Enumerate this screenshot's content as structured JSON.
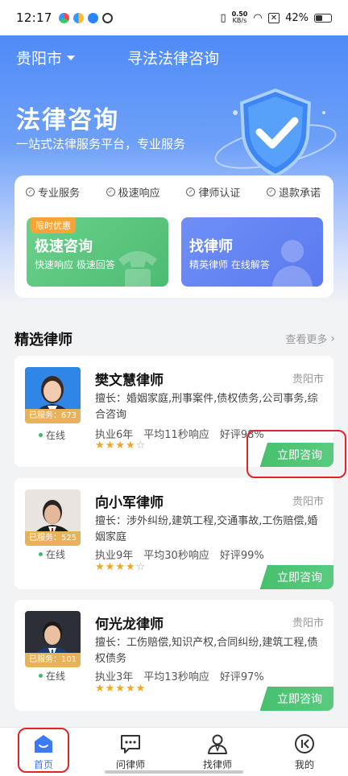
{
  "status": {
    "time": "12:17",
    "speed_value": "0.50",
    "speed_unit": "KB/s",
    "battery": "42%"
  },
  "header": {
    "city": "贵阳市",
    "title": "寻法法律咨询"
  },
  "hero": {
    "title": "法律咨询",
    "subtitle": "一站式法律服务平台，专业服务"
  },
  "features": [
    "专业服务",
    "极速响应",
    "律师认证",
    "退款承诺"
  ],
  "tiles": {
    "quick": {
      "badge": "限时优惠",
      "title": "极速咨询",
      "desc": "快速响应 极速回答"
    },
    "find": {
      "title": "找律师",
      "desc": "精英律师 在线解答"
    }
  },
  "section": {
    "title": "精选律师",
    "more": "查看更多"
  },
  "lawyers": [
    {
      "name": "樊文慧律师",
      "location": "贵阳市",
      "served": "已服务：673人",
      "status": "在线",
      "specialty": "擅长：婚姻家庭,刑事案件,债权债务,公司事务,综合咨询",
      "years": "执业6年",
      "response": "平均11秒响应",
      "rating": "好评98%",
      "stars": 4,
      "button": "立即咨询"
    },
    {
      "name": "向小军律师",
      "location": "贵阳市",
      "served": "已服务：525人",
      "status": "在线",
      "specialty": "擅长：涉外纠纷,建筑工程,交通事故,工伤赔偿,婚姻家庭",
      "years": "执业9年",
      "response": "平均30秒响应",
      "rating": "好评99%",
      "stars": 4,
      "button": "立即咨询"
    },
    {
      "name": "何光龙律师",
      "location": "贵阳市",
      "served": "已服务：101人",
      "status": "在线",
      "specialty": "擅长：工伤赔偿,知识产权,合同纠纷,建筑工程,债权债务",
      "years": "执业3年",
      "response": "平均13秒响应",
      "rating": "好评97%",
      "stars": 5,
      "button": "立即咨询"
    }
  ],
  "nav": [
    {
      "label": "首页",
      "icon": "home-icon",
      "active": true
    },
    {
      "label": "问律师",
      "icon": "chat-icon",
      "active": false
    },
    {
      "label": "找律师",
      "icon": "lawyer-icon",
      "active": false
    },
    {
      "label": "我的",
      "icon": "profile-icon",
      "active": false
    }
  ],
  "colors": {
    "primary": "#3a7af5",
    "green": "#47c06e",
    "highlight": "#e0242a",
    "star": "#f2a623"
  }
}
